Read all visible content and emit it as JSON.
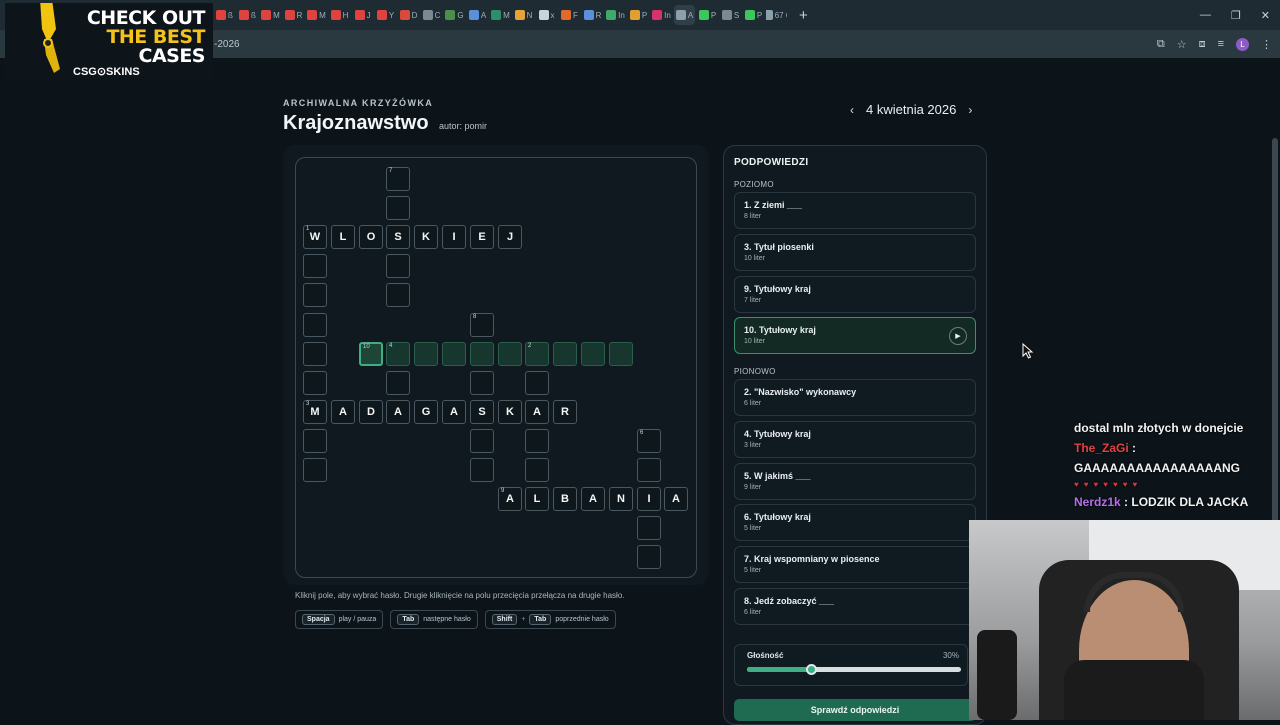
{
  "browser": {
    "tabs": [
      "ß",
      "ß",
      "M",
      "R",
      "M",
      "H",
      "J",
      "Y",
      "D",
      "C",
      "G",
      "A",
      "M",
      "N",
      "x",
      "F",
      "R",
      "In",
      "P",
      "In",
      "A",
      "P",
      "S",
      "P",
      "67 6"
    ],
    "active_tab_index": 20,
    "address_fragment": "-2026"
  },
  "ad": {
    "line1": "CHECK OUT",
    "line2": "THE BEST",
    "line3": "CASES",
    "brand": "CSG⊙SKINS"
  },
  "header": {
    "eyebrow": "ARCHIWALNA KRZYŻÓWKA",
    "title": "Krajoznawstwo",
    "author": "autor: pomir",
    "date": "4 kwietnia 2026"
  },
  "grid": {
    "cells": [
      {
        "c": 3,
        "r": 0,
        "n": "7"
      },
      {
        "c": 3,
        "r": 1
      },
      {
        "c": 0,
        "r": 2,
        "n": "1",
        "l": "W"
      },
      {
        "c": 1,
        "r": 2,
        "l": "L"
      },
      {
        "c": 2,
        "r": 2,
        "l": "O"
      },
      {
        "c": 3,
        "r": 2,
        "l": "S"
      },
      {
        "c": 4,
        "r": 2,
        "l": "K"
      },
      {
        "c": 5,
        "r": 2,
        "l": "I"
      },
      {
        "c": 6,
        "r": 2,
        "l": "E"
      },
      {
        "c": 7,
        "r": 2,
        "l": "J"
      },
      {
        "c": 0,
        "r": 3
      },
      {
        "c": 3,
        "r": 3
      },
      {
        "c": 0,
        "r": 4
      },
      {
        "c": 3,
        "r": 4
      },
      {
        "c": 0,
        "r": 5
      },
      {
        "c": 6,
        "r": 5,
        "n": "8"
      },
      {
        "c": 0,
        "r": 6
      },
      {
        "c": 2,
        "r": 6,
        "n": "10",
        "s": "active"
      },
      {
        "c": 3,
        "r": 6,
        "n": "4",
        "s": "hl"
      },
      {
        "c": 4,
        "r": 6,
        "s": "hl"
      },
      {
        "c": 5,
        "r": 6,
        "s": "hl"
      },
      {
        "c": 6,
        "r": 6,
        "s": "hl"
      },
      {
        "c": 7,
        "r": 6,
        "s": "hl"
      },
      {
        "c": 8,
        "r": 6,
        "n": "2",
        "s": "hl"
      },
      {
        "c": 9,
        "r": 6,
        "s": "hl"
      },
      {
        "c": 10,
        "r": 6,
        "s": "hl"
      },
      {
        "c": 11,
        "r": 6,
        "s": "hl"
      },
      {
        "c": 0,
        "r": 7
      },
      {
        "c": 3,
        "r": 7
      },
      {
        "c": 6,
        "r": 7
      },
      {
        "c": 8,
        "r": 7
      },
      {
        "c": 0,
        "r": 8,
        "n": "3",
        "l": "M"
      },
      {
        "c": 1,
        "r": 8,
        "l": "A"
      },
      {
        "c": 2,
        "r": 8,
        "l": "D"
      },
      {
        "c": 3,
        "r": 8,
        "l": "A"
      },
      {
        "c": 4,
        "r": 8,
        "l": "G"
      },
      {
        "c": 5,
        "r": 8,
        "l": "A"
      },
      {
        "c": 6,
        "r": 8,
        "l": "S"
      },
      {
        "c": 7,
        "r": 8,
        "l": "K"
      },
      {
        "c": 8,
        "r": 8,
        "l": "A"
      },
      {
        "c": 9,
        "r": 8,
        "l": "R"
      },
      {
        "c": 0,
        "r": 9
      },
      {
        "c": 6,
        "r": 9
      },
      {
        "c": 8,
        "r": 9
      },
      {
        "c": 12,
        "r": 9,
        "n": "6"
      },
      {
        "c": 0,
        "r": 10
      },
      {
        "c": 6,
        "r": 10
      },
      {
        "c": 8,
        "r": 10
      },
      {
        "c": 12,
        "r": 10
      },
      {
        "c": 7,
        "r": 11,
        "n": "9",
        "l": "A"
      },
      {
        "c": 8,
        "r": 11,
        "l": "L"
      },
      {
        "c": 9,
        "r": 11,
        "l": "B"
      },
      {
        "c": 10,
        "r": 11,
        "l": "A"
      },
      {
        "c": 11,
        "r": 11,
        "l": "N"
      },
      {
        "c": 12,
        "r": 11,
        "l": "I"
      },
      {
        "c": 13,
        "r": 11,
        "l": "A"
      },
      {
        "c": 12,
        "r": 12
      },
      {
        "c": 12,
        "r": 13
      }
    ]
  },
  "help": {
    "text": "Kliknij pole, aby wybrać hasło. Drugie kliknięcie na polu przecięcia przełącza na drugie hasło.",
    "shortcuts": [
      {
        "keys": [
          "Spacja"
        ],
        "label": "play / pauza"
      },
      {
        "keys": [
          "Tab"
        ],
        "label": "następne hasło"
      },
      {
        "keys": [
          "Shift",
          "Tab"
        ],
        "label": "poprzednie hasło"
      }
    ]
  },
  "clues": {
    "title": "PODPOWIEDZI",
    "across_label": "POZIOMO",
    "down_label": "PIONOWO",
    "across": [
      {
        "label": "1. Z ziemi ___",
        "len": "8 liter"
      },
      {
        "label": "3. Tytuł piosenki",
        "len": "10 liter"
      },
      {
        "label": "9. Tytułowy kraj",
        "len": "7 liter"
      },
      {
        "label": "10. Tytułowy kraj",
        "len": "10 liter",
        "selected": true
      }
    ],
    "down": [
      {
        "label": "2. \"Nazwisko\" wykonawcy",
        "len": "6 liter"
      },
      {
        "label": "4. Tytułowy kraj",
        "len": "3 liter"
      },
      {
        "label": "5. W jakimś ___",
        "len": "9 liter"
      },
      {
        "label": "6. Tytułowy kraj",
        "len": "5 liter"
      },
      {
        "label": "7. Kraj wspomniany w piosence",
        "len": "5 liter"
      },
      {
        "label": "8. Jedź zobaczyć ___",
        "len": "6 liter"
      }
    ]
  },
  "volume": {
    "label": "Głośność",
    "value_text": "30%",
    "level": 0.3
  },
  "check_button": "Sprawdź odpowiedzi",
  "chat": {
    "line1": "dostal mln złotych w donejcie",
    "user2": "The_ZaGi",
    "msg2": "GAAAAAAAAAAAAAAAANG",
    "user3": "Nerdz1k",
    "msg3": "LODZIK DLA JACKA"
  },
  "colors": {
    "accent": "#3fae82",
    "highlight": "#17362d",
    "page_bg": "#0c141a",
    "chat_red": "#e0433f",
    "chat_purple": "#b76ee8"
  }
}
